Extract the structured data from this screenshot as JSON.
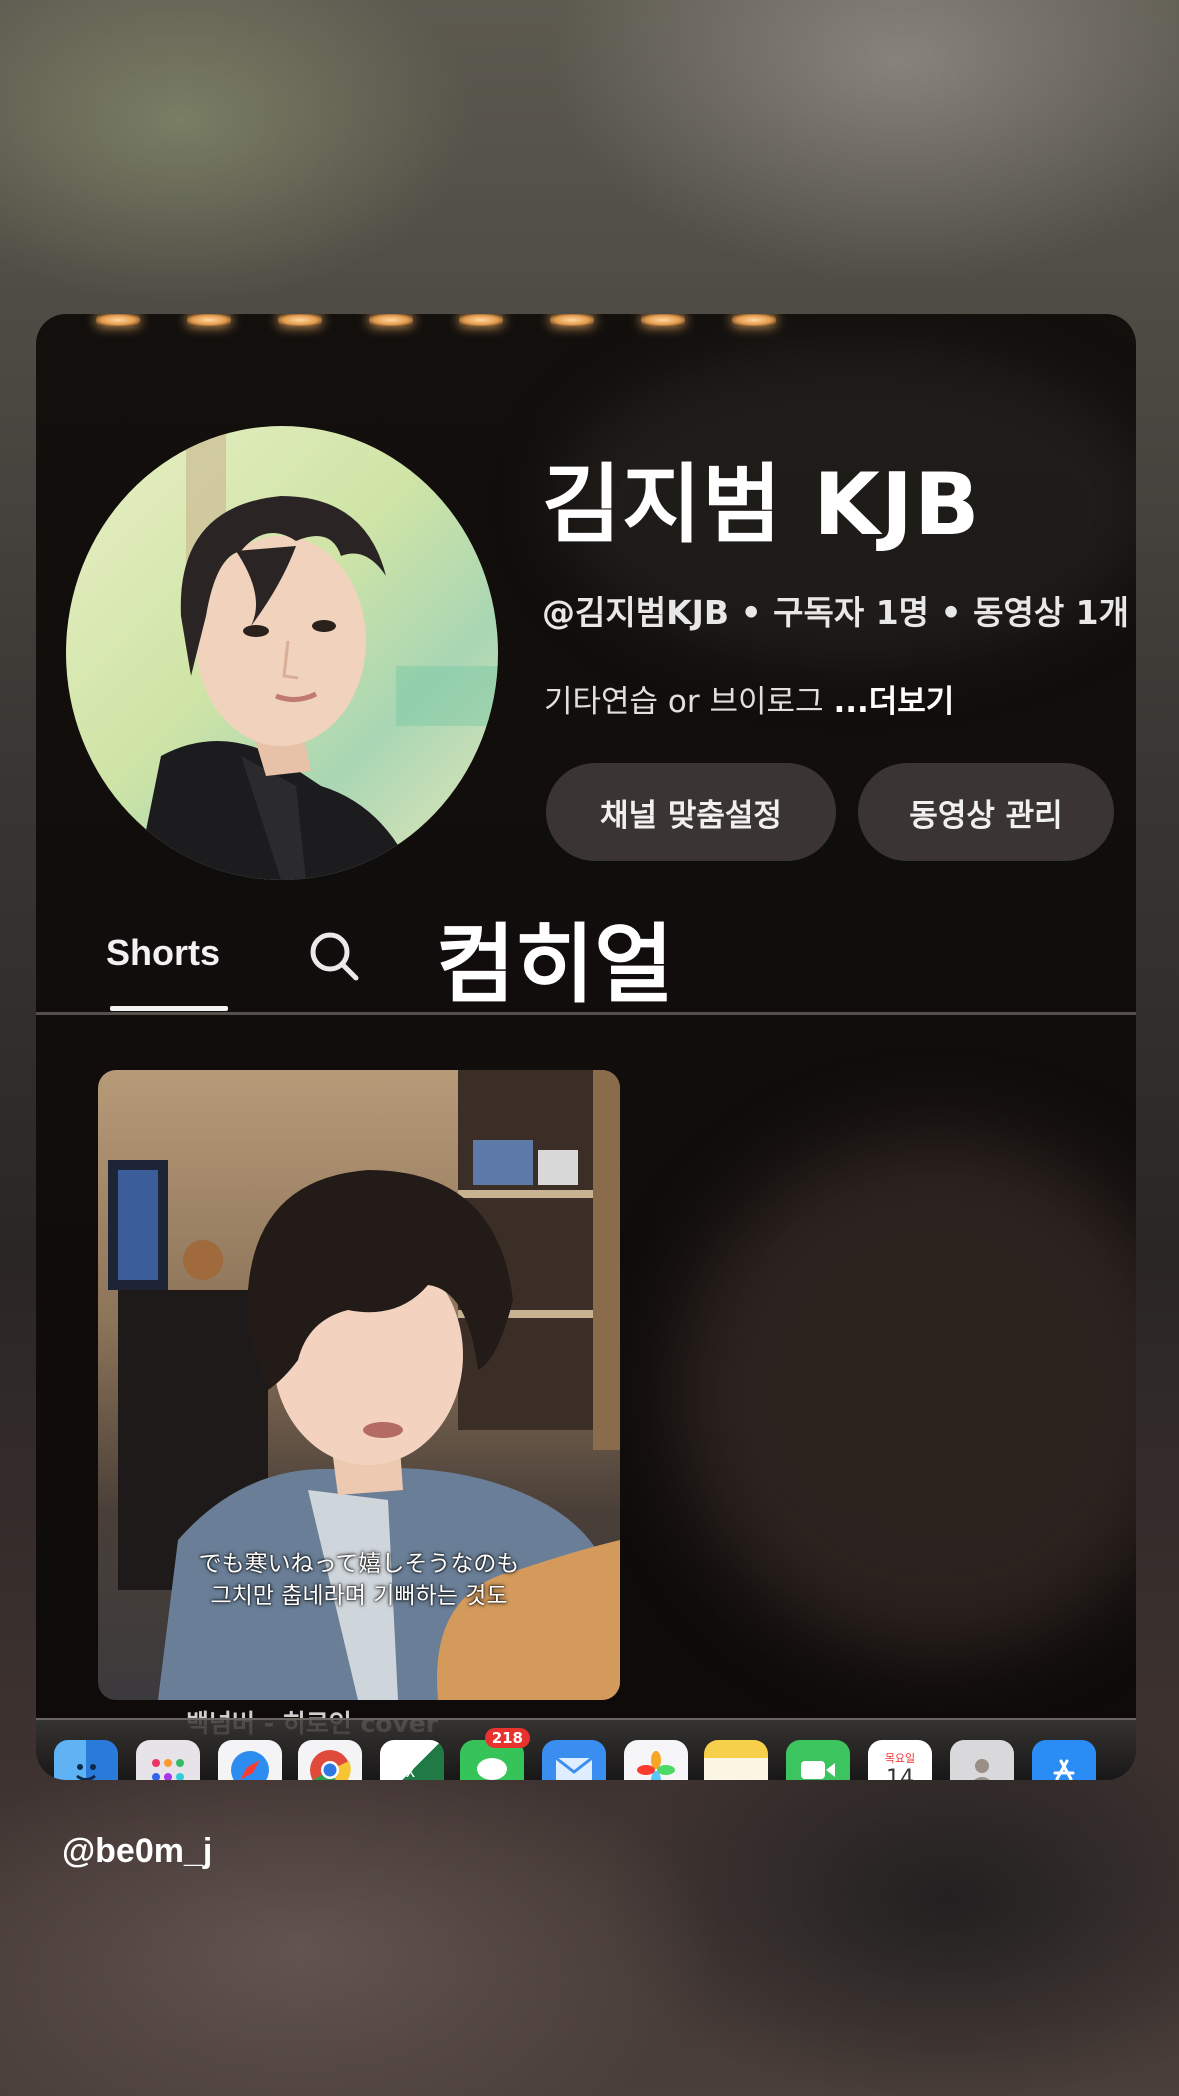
{
  "channel": {
    "name": "김지범 KJB",
    "meta": "@김지범KJB • 구독자 1명 • 동영상 1개",
    "description": "기타연습 or 브이로그 ",
    "more_label": "...더보기",
    "buttons": {
      "customize": "채널 맞춤설정",
      "manage_videos": "동영상 관리"
    }
  },
  "tabs": {
    "shorts_label": "Shorts"
  },
  "sticker": {
    "text": "컴히얼"
  },
  "short": {
    "subtitle_line1": "でも寒いねって嬉しそうなのも",
    "subtitle_line2": "그치만 춥네라며 기뻐하는 것도",
    "title": "백넘버 - 히로인 cover"
  },
  "dock": {
    "messages_badge": "218",
    "calendar_day": "14",
    "calendar_weekday": "목요일"
  },
  "story": {
    "username": "@be0m_j"
  },
  "colors": {
    "frame_background": "#120f0d",
    "button_background": "#3a3532",
    "badge_red": "#e8322d"
  }
}
